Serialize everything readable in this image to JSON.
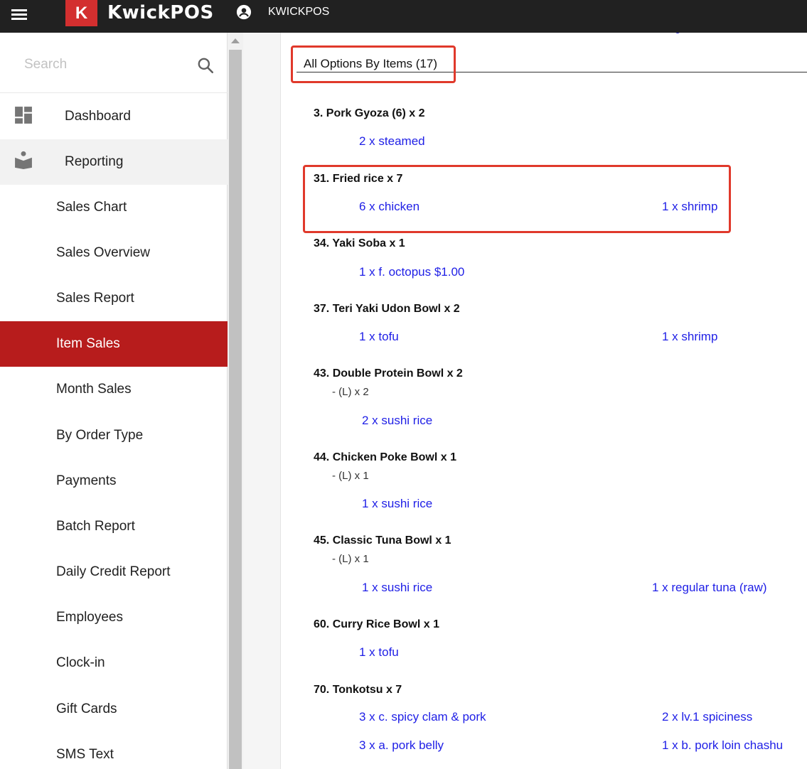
{
  "app": {
    "brand": "KwickPOS",
    "logo_letter": "K",
    "user": "KWICKPOS"
  },
  "sidebar": {
    "search_placeholder": "Search",
    "items": [
      {
        "label": "Dashboard",
        "icon": "dashboard-icon"
      },
      {
        "label": "Reporting",
        "icon": "reporting-icon"
      },
      {
        "label": "Sales Chart"
      },
      {
        "label": "Sales Overview"
      },
      {
        "label": "Sales Report"
      },
      {
        "label": "Item Sales"
      },
      {
        "label": "Month Sales"
      },
      {
        "label": "By Order Type"
      },
      {
        "label": "Payments"
      },
      {
        "label": "Batch Report"
      },
      {
        "label": "Daily Credit Report"
      },
      {
        "label": "Employees"
      },
      {
        "label": "Clock-in"
      },
      {
        "label": "Gift Cards"
      },
      {
        "label": "SMS Text"
      }
    ]
  },
  "main": {
    "section_title": "All Options By Items (17)",
    "items": [
      {
        "name": "3. Pork Gyoza (6) x 2",
        "options": [
          "2 x steamed"
        ]
      },
      {
        "name": "31. Fried rice x 7",
        "options": [
          "6 x chicken",
          "1 x shrimp"
        ]
      },
      {
        "name": "34. Yaki Soba x 1",
        "options": [
          "1 x f. octopus $1.00"
        ]
      },
      {
        "name": "37. Teri Yaki Udon Bowl x 2",
        "options": [
          "1 x tofu",
          "1 x shrimp"
        ]
      },
      {
        "name": "43. Double Protein Bowl x 2",
        "sub": "- (L) x 2",
        "options": [
          "2 x sushi rice"
        ]
      },
      {
        "name": "44. Chicken Poke Bowl x 1",
        "sub": "- (L) x 1",
        "options": [
          "1 x sushi rice"
        ]
      },
      {
        "name": "45. Classic Tuna Bowl x 1",
        "sub": "- (L) x 1",
        "options": [
          "1 x sushi rice",
          "1 x regular tuna (raw)"
        ]
      },
      {
        "name": "60. Curry Rice Bowl x 1",
        "options": [
          "1 x tofu"
        ]
      },
      {
        "name": "70. Tonkotsu x 7",
        "options": [
          "3 x c. spicy clam & pork",
          "2 x lv.1 spiciness",
          "3 x a. pork belly",
          "1 x b. pork loin chashu"
        ]
      }
    ]
  },
  "colors": {
    "topbar": "#212121",
    "brand_red": "#d32f2f",
    "active_item": "#b71c1c",
    "option_link": "#1e1ee6",
    "highlight_box": "#e0392b"
  }
}
